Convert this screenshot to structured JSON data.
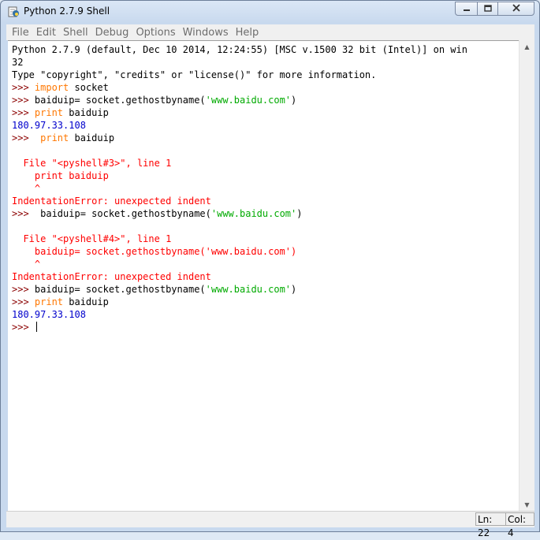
{
  "window": {
    "title": "Python 2.7.9 Shell",
    "minimize": "▭",
    "maximize": "▢",
    "close": "✕",
    "icon": "python-shell-icon"
  },
  "menubar": {
    "items": [
      "File",
      "Edit",
      "Shell",
      "Debug",
      "Options",
      "Windows",
      "Help"
    ]
  },
  "shell": {
    "lines": [
      [
        {
          "t": "Python 2.7.9 (default, Dec 10 2014, 12:24:55) [MSC v.1500 32 bit (Intel)] on win",
          "c": ""
        }
      ],
      [
        {
          "t": "32",
          "c": ""
        }
      ],
      [
        {
          "t": "Type \"copyright\", \"credits\" or \"license()\" for more information.",
          "c": ""
        }
      ],
      [
        {
          "t": ">>> ",
          "c": "prompt"
        },
        {
          "t": "import",
          "c": "kw"
        },
        {
          "t": " socket",
          "c": ""
        }
      ],
      [
        {
          "t": ">>> ",
          "c": "prompt"
        },
        {
          "t": "baiduip= socket.gethostbyname(",
          "c": ""
        },
        {
          "t": "'www.baidu.com'",
          "c": "str"
        },
        {
          "t": ")",
          "c": ""
        }
      ],
      [
        {
          "t": ">>> ",
          "c": "prompt"
        },
        {
          "t": "print",
          "c": "kw"
        },
        {
          "t": " baiduip",
          "c": ""
        }
      ],
      [
        {
          "t": "180.97.33.108",
          "c": "out"
        }
      ],
      [
        {
          "t": ">>>  ",
          "c": "prompt"
        },
        {
          "t": "print",
          "c": "kw"
        },
        {
          "t": " baiduip",
          "c": ""
        }
      ],
      [
        {
          "t": "",
          "c": ""
        }
      ],
      [
        {
          "t": "  File \"<pyshell#3>\", line 1",
          "c": "err"
        }
      ],
      [
        {
          "t": "    print baiduip",
          "c": "err"
        }
      ],
      [
        {
          "t": "    ^",
          "c": "err"
        }
      ],
      [
        {
          "t": "IndentationError: unexpected indent",
          "c": "err"
        }
      ],
      [
        {
          "t": ">>>  ",
          "c": "prompt"
        },
        {
          "t": "baiduip= socket.gethostbyname(",
          "c": ""
        },
        {
          "t": "'www.baidu.com'",
          "c": "str"
        },
        {
          "t": ")",
          "c": ""
        }
      ],
      [
        {
          "t": "",
          "c": ""
        }
      ],
      [
        {
          "t": "  File \"<pyshell#4>\", line 1",
          "c": "err"
        }
      ],
      [
        {
          "t": "    baiduip= socket.gethostbyname('www.baidu.com')",
          "c": "err"
        }
      ],
      [
        {
          "t": "    ^",
          "c": "err"
        }
      ],
      [
        {
          "t": "IndentationError: unexpected indent",
          "c": "err"
        }
      ],
      [
        {
          "t": ">>> ",
          "c": "prompt"
        },
        {
          "t": "baiduip= socket.gethostbyname(",
          "c": ""
        },
        {
          "t": "'www.baidu.com'",
          "c": "str"
        },
        {
          "t": ")",
          "c": ""
        }
      ],
      [
        {
          "t": ">>> ",
          "c": "prompt"
        },
        {
          "t": "print",
          "c": "kw"
        },
        {
          "t": " baiduip",
          "c": ""
        }
      ],
      [
        {
          "t": "180.97.33.108",
          "c": "out"
        }
      ],
      [
        {
          "t": ">>> ",
          "c": "prompt"
        }
      ]
    ]
  },
  "scrollbar": {
    "up": "▲",
    "down": "▼"
  },
  "status": {
    "ln": "Ln: 22",
    "col": "Col: 4"
  },
  "colors": {
    "prompt": "#8b0000",
    "keyword": "#ff7700",
    "string": "#00aa00",
    "output": "#0000cc",
    "error": "#ff0000"
  }
}
